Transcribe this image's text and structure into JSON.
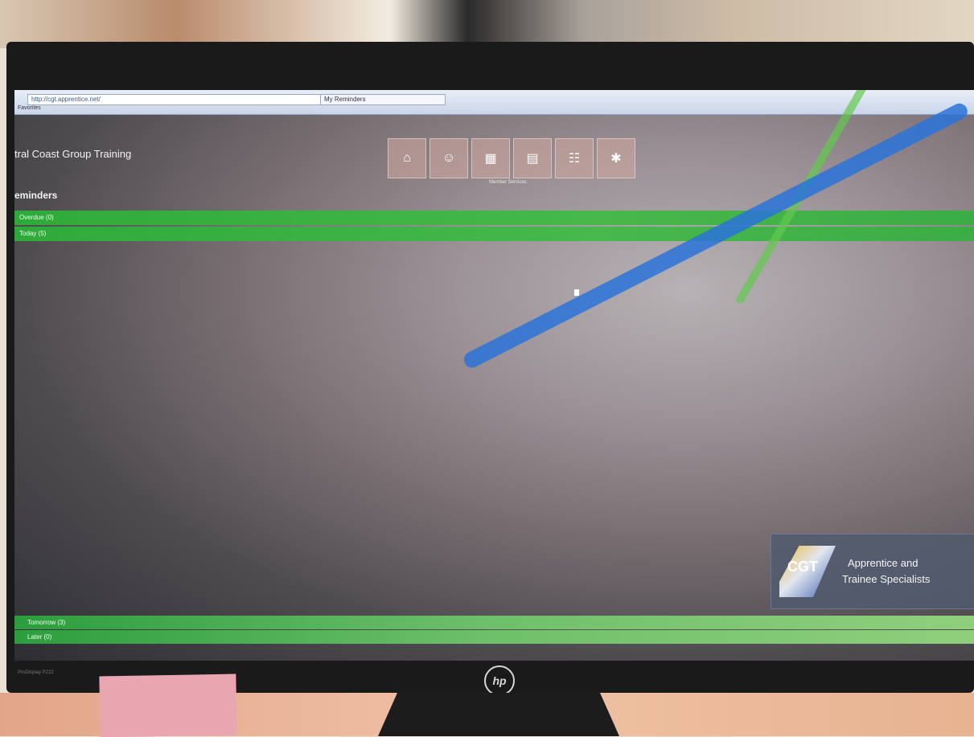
{
  "browser": {
    "address_text": "http://cgt.apprentice.net/",
    "tab_text": "My Reminders",
    "favorites_text": "Favorites"
  },
  "app": {
    "title": "tral Coast Group Training",
    "section_title": "eminders",
    "tiles_caption": "Member Services"
  },
  "reminders": {
    "rows_top": [
      "Overdue (0)",
      "Today (5)"
    ],
    "rows_bottom": [
      "Tomorrow (3)",
      "Later (0)"
    ]
  },
  "logo": {
    "mark_text": "CGT",
    "line1": "Apprentice and",
    "line2": "Trainee Specialists"
  },
  "monitor": {
    "brand_text": "hp",
    "bezel_text": "ProDisplay P222"
  },
  "colors": {
    "bar_green": "#46b84c",
    "accent_blue": "#2a73d9"
  },
  "icons": [
    "home-icon",
    "user-icon",
    "calendar-icon",
    "document-icon",
    "group-icon",
    "settings-icon"
  ]
}
